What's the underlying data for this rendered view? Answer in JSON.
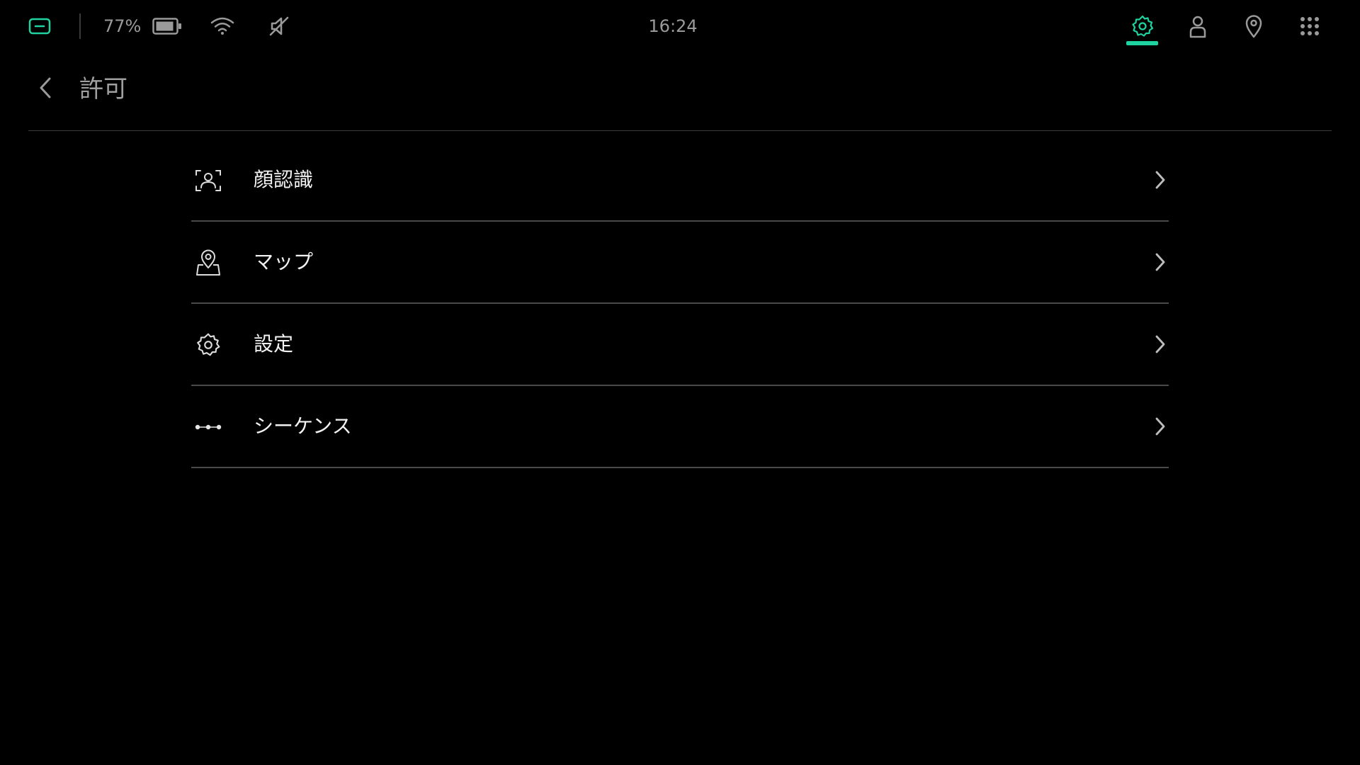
{
  "colors": {
    "accent": "#1fd3a0",
    "background": "#000000",
    "text_primary": "#f2f2f2",
    "text_secondary": "#9a9a9a",
    "divider": "#4a4a4a"
  },
  "status_bar": {
    "left_icon": "tablet-mode-icon",
    "battery_percent": "77%",
    "battery_icon": "battery-icon",
    "wifi_icon": "wifi-icon",
    "sound_icon": "sound-muted-icon",
    "time": "16:24",
    "right_icons": [
      {
        "name": "settings-tab-icon",
        "active": true
      },
      {
        "name": "user-tab-icon",
        "active": false
      },
      {
        "name": "location-tab-icon",
        "active": false
      },
      {
        "name": "apps-grid-icon",
        "active": false
      }
    ]
  },
  "header": {
    "back_icon": "chevron-left-icon",
    "title": "許可"
  },
  "menu": {
    "items": [
      {
        "icon": "face-recognition-icon",
        "label": "顔認識"
      },
      {
        "icon": "map-pin-icon",
        "label": "マップ"
      },
      {
        "icon": "gear-icon",
        "label": "設定"
      },
      {
        "icon": "more-dots-icon",
        "label": "シーケンス"
      }
    ],
    "chevron_icon": "chevron-right-icon"
  }
}
